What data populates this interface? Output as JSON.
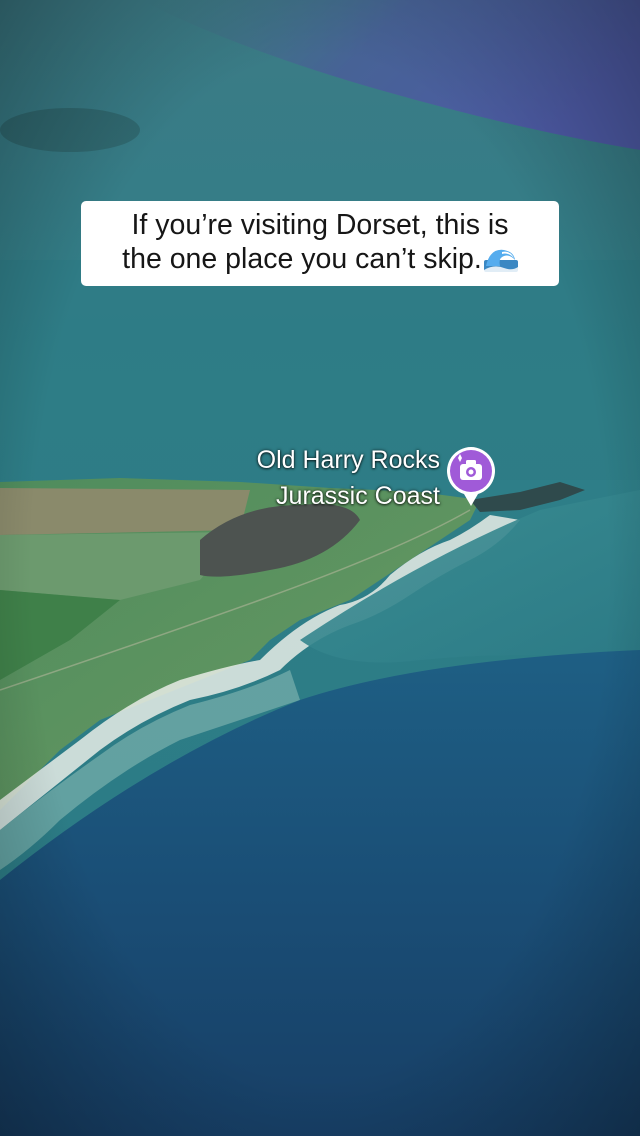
{
  "caption": {
    "line1": "If you’re visiting Dorset, this is",
    "line2": "the one place you can’t skip.",
    "emoji": "🌊"
  },
  "place": {
    "name": "Old Harry Rocks",
    "subtitle": "Jurassic Coast",
    "pin_icon": "camera-icon",
    "pin_color": "#a05ad8"
  }
}
